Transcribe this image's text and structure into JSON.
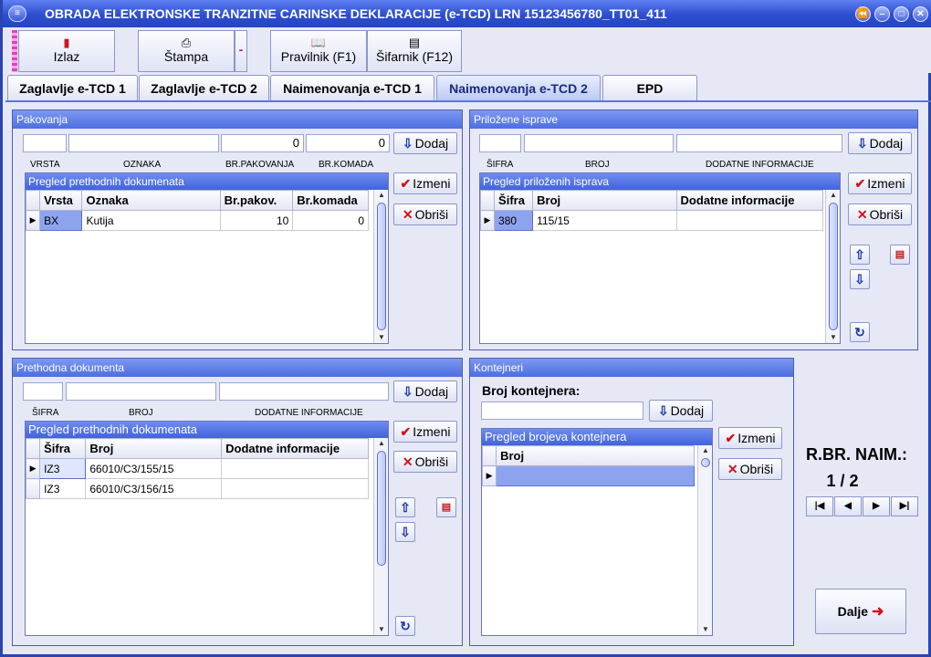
{
  "window": {
    "title": "OBRADA ELEKTRONSKE TRANZITNE CARINSKE DEKLARACIJE (e-TCD)  LRN 15123456780_TT01_411",
    "menu_icon": "≡",
    "controls": [
      "⏪",
      "–",
      "□",
      "✕"
    ]
  },
  "toolbar": {
    "exit_label": "Izlaz",
    "print_label": "Štampa",
    "print_menu_label": "-",
    "rulebook_label": "Pravilnik (F1)",
    "codebook_label": "Šifarnik (F12)"
  },
  "tabs": [
    {
      "label": "Zaglavlje e-TCD 1"
    },
    {
      "label": "Zaglavlje e-TCD 2"
    },
    {
      "label": "Naimenovanja e-TCD 1"
    },
    {
      "label": "Naimenovanja e-TCD 2",
      "active": true
    },
    {
      "label": "EPD"
    }
  ],
  "packaging": {
    "title": "Pakovanja",
    "inputs": {
      "vrsta": "",
      "oznaka": "",
      "br_pakovanja": "0",
      "br_komada": "0"
    },
    "labels": {
      "vrsta": "VRSTA",
      "oznaka": "OZNAKA",
      "br_pakovanja": "BR.PAKOVANJA",
      "br_komada": "BR.KOMADA"
    },
    "add_label": "Dodaj",
    "edit_label": "Izmeni",
    "delete_label": "Obriši",
    "grid_title": "Pregled prethodnih dokumenata",
    "columns": [
      "Vrsta",
      "Oznaka",
      "Br.pakov.",
      "Br.komada"
    ],
    "rows": [
      {
        "vrsta": "BX",
        "oznaka": "Kutija",
        "br_pakov": "10",
        "br_komada": "0"
      }
    ]
  },
  "attached_docs": {
    "title": "Priložene isprave",
    "labels": {
      "sifra": "ŠIFRA",
      "broj": "BROJ",
      "dodatne": "DODATNE INFORMACIJE"
    },
    "add_label": "Dodaj",
    "edit_label": "Izmeni",
    "delete_label": "Obriši",
    "grid_title": "Pregled priloženih isprava",
    "columns": [
      "Šifra",
      "Broj",
      "Dodatne informacije"
    ],
    "rows": [
      {
        "sifra": "380",
        "broj": "115/15",
        "dodatne": ""
      }
    ]
  },
  "previous_docs": {
    "title": "Prethodna dokumenta",
    "labels": {
      "sifra": "ŠIFRA",
      "broj": "BROJ",
      "dodatne": "DODATNE INFORMACIJE"
    },
    "add_label": "Dodaj",
    "edit_label": "Izmeni",
    "delete_label": "Obriši",
    "grid_title": "Pregled prethodnih dokumenata",
    "columns": [
      "Šifra",
      "Broj",
      "Dodatne informacije"
    ],
    "rows": [
      {
        "sifra": "IZ3",
        "broj": "66010/C3/155/15",
        "dodatne": ""
      },
      {
        "sifra": "IZ3",
        "broj": "66010/C3/156/15",
        "dodatne": ""
      }
    ]
  },
  "containers": {
    "title": "Kontejneri",
    "number_label": "Broj kontejnera:",
    "input_value": "",
    "add_label": "Dodaj",
    "edit_label": "Izmeni",
    "delete_label": "Obriši",
    "grid_title": "Pregled brojeva kontejnera",
    "columns": [
      "Broj"
    ],
    "rows": [
      {
        "broj": ""
      }
    ]
  },
  "navigation": {
    "label": "R.BR. NAIM.:",
    "position": "1 / 2",
    "next_label": "Dalje"
  }
}
